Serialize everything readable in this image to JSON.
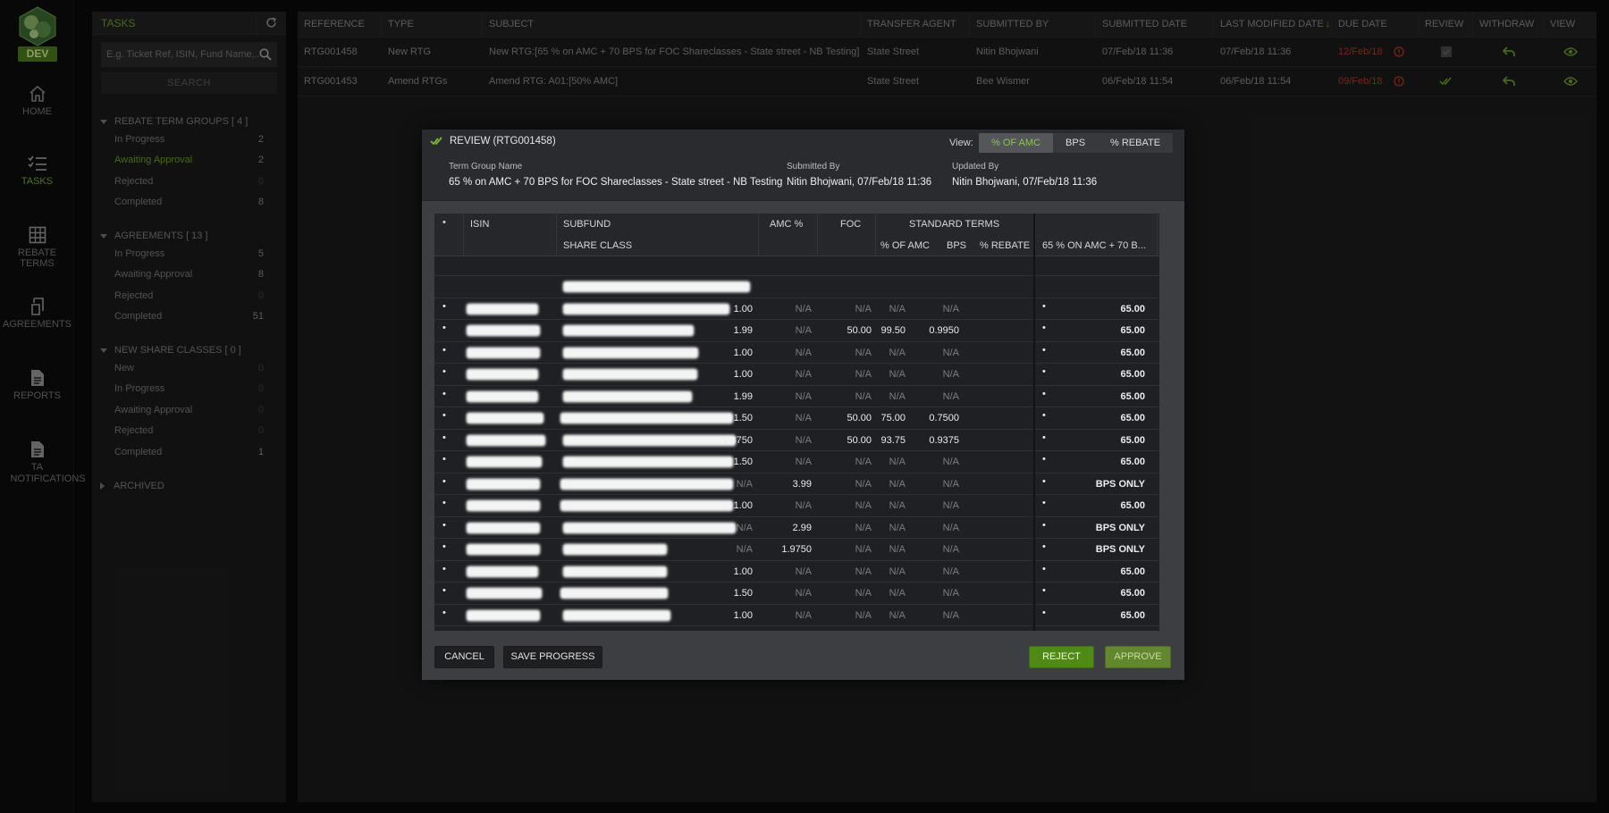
{
  "app": {
    "env_badge": "DEV"
  },
  "nav": [
    {
      "label": "HOME",
      "icon": "home-icon"
    },
    {
      "label": "TASKS",
      "icon": "tasks-icon"
    },
    {
      "label": "REBATE TERMS",
      "icon": "grid-icon"
    },
    {
      "label": "AGREEMENTS",
      "icon": "agreement-icon"
    },
    {
      "label": "REPORTS",
      "icon": "report-icon"
    },
    {
      "label": "TA NOTIFICATIONS",
      "icon": "notification-doc-icon"
    }
  ],
  "tasks_panel": {
    "title": "TASKS",
    "search_placeholder": "E.g. Ticket Ref, ISIN, Fund Name,...",
    "search_button": "SEARCH",
    "sections": [
      {
        "title": "REBATE TERM GROUPS [ 4 ]",
        "items": [
          {
            "label": "In Progress",
            "count": "2"
          },
          {
            "label": "Awaiting Approval",
            "count": "2"
          },
          {
            "label": "Rejected",
            "count": "0"
          },
          {
            "label": "Completed",
            "count": "8"
          }
        ]
      },
      {
        "title": "AGREEMENTS [ 13 ]",
        "items": [
          {
            "label": "In Progress",
            "count": "5"
          },
          {
            "label": "Awaiting Approval",
            "count": "8"
          },
          {
            "label": "Rejected",
            "count": "0"
          },
          {
            "label": "Completed",
            "count": "51"
          }
        ]
      },
      {
        "title": "NEW SHARE CLASSES [ 0 ]",
        "items": [
          {
            "label": "New",
            "count": "0"
          },
          {
            "label": "In Progress",
            "count": "0"
          },
          {
            "label": "Awaiting Approval",
            "count": "0"
          },
          {
            "label": "Rejected",
            "count": "0"
          },
          {
            "label": "Completed",
            "count": "1"
          }
        ]
      }
    ],
    "archived": "ARCHIVED"
  },
  "grid": {
    "columns": [
      "REFERENCE",
      "TYPE",
      "SUBJECT",
      "TRANSFER AGENT",
      "SUBMITTED BY",
      "SUBMITTED DATE",
      "LAST MODIFIED DATE",
      "DUE DATE",
      "REVIEW",
      "WITHDRAW",
      "VIEW"
    ],
    "rows": [
      {
        "reference": "RTG001458",
        "type": "New RTG",
        "subject": "New RTG:[65 % on AMC + 70 BPS for FOC Shareclasses - State street - NB Testing]",
        "agent": "State Street",
        "submitted_by": "Nitin Bhojwani",
        "submitted_date": "07/Feb/18 11:36",
        "modified": "07/Feb/18 11:36",
        "due": "12/Feb/18"
      },
      {
        "reference": "RTG001453",
        "type": "Amend RTGs",
        "subject": "Amend RTG: A01:[50% AMC]",
        "agent": "State Street",
        "submitted_by": "Bee Wismer",
        "submitted_date": "06/Feb/18 11:54",
        "modified": "06/Feb/18 11:54",
        "due": "09/Feb/18"
      }
    ]
  },
  "modal": {
    "title": "REVIEW (RTG001458)",
    "view_label": "View:",
    "view_options": [
      "% OF AMC",
      "BPS",
      "% REBATE"
    ],
    "term_group_label": "Term Group Name",
    "term_group_value": "65 % on AMC + 70 BPS for FOC Shareclasses - State street - NB Testing",
    "submitted_label": "Submitted By",
    "submitted_value": "Nitin Bhojwani, 07/Feb/18 11:36",
    "updated_label": "Updated By",
    "updated_value": "Nitin Bhojwani, 07/Feb/18 11:36",
    "table_headers": {
      "bullet": "•",
      "isin": "ISIN",
      "subfund": "SUBFUND",
      "share_class": "SHARE CLASS",
      "amc": "AMC %",
      "foc": "FOC",
      "standard_terms": "STANDARD TERMS",
      "pct_amc": "% OF AMC",
      "bps": "BPS",
      "pct_rebate": "% REBATE",
      "proposed": "65 % ON AMC + 70 B..."
    },
    "rows": [
      {
        "amc": "1.00",
        "foc": "N/A",
        "pct_amc": "N/A",
        "bps": "N/A",
        "rebate": "N/A",
        "value": "65.00"
      },
      {
        "amc": "1.99",
        "foc": "N/A",
        "pct_amc": "50.00",
        "bps": "99.50",
        "rebate": "0.9950",
        "value": "65.00"
      },
      {
        "amc": "1.00",
        "foc": "N/A",
        "pct_amc": "N/A",
        "bps": "N/A",
        "rebate": "N/A",
        "value": "65.00"
      },
      {
        "amc": "1.00",
        "foc": "N/A",
        "pct_amc": "N/A",
        "bps": "N/A",
        "rebate": "N/A",
        "value": "65.00"
      },
      {
        "amc": "1.99",
        "foc": "N/A",
        "pct_amc": "N/A",
        "bps": "N/A",
        "rebate": "N/A",
        "value": "65.00"
      },
      {
        "amc": "1.50",
        "foc": "N/A",
        "pct_amc": "50.00",
        "bps": "75.00",
        "rebate": "0.7500",
        "value": "65.00"
      },
      {
        "amc": "1.8750",
        "foc": "N/A",
        "pct_amc": "50.00",
        "bps": "93.75",
        "rebate": "0.9375",
        "value": "65.00"
      },
      {
        "amc": "1.50",
        "foc": "N/A",
        "pct_amc": "N/A",
        "bps": "N/A",
        "rebate": "N/A",
        "value": "65.00"
      },
      {
        "amc": "N/A",
        "foc": "3.99",
        "pct_amc": "N/A",
        "bps": "N/A",
        "rebate": "N/A",
        "value": "BPS ONLY"
      },
      {
        "amc": "1.00",
        "foc": "N/A",
        "pct_amc": "N/A",
        "bps": "N/A",
        "rebate": "N/A",
        "value": "65.00"
      },
      {
        "amc": "N/A",
        "foc": "2.99",
        "pct_amc": "N/A",
        "bps": "N/A",
        "rebate": "N/A",
        "value": "BPS ONLY"
      },
      {
        "amc": "N/A",
        "foc": "1.9750",
        "pct_amc": "N/A",
        "bps": "N/A",
        "rebate": "N/A",
        "value": "BPS ONLY"
      },
      {
        "amc": "1.00",
        "foc": "N/A",
        "pct_amc": "N/A",
        "bps": "N/A",
        "rebate": "N/A",
        "value": "65.00"
      },
      {
        "amc": "1.50",
        "foc": "N/A",
        "pct_amc": "N/A",
        "bps": "N/A",
        "rebate": "N/A",
        "value": "65.00"
      },
      {
        "amc": "1.00",
        "foc": "N/A",
        "pct_amc": "N/A",
        "bps": "N/A",
        "rebate": "N/A",
        "value": "65.00"
      }
    ],
    "buttons": {
      "cancel": "CANCEL",
      "save": "SAVE PROGRESS",
      "reject": "REJECT",
      "approve": "APPROVE"
    }
  },
  "colors": {
    "accent": "#6f9d31",
    "danger": "#b53a2a",
    "reject": "#4e8a15"
  }
}
